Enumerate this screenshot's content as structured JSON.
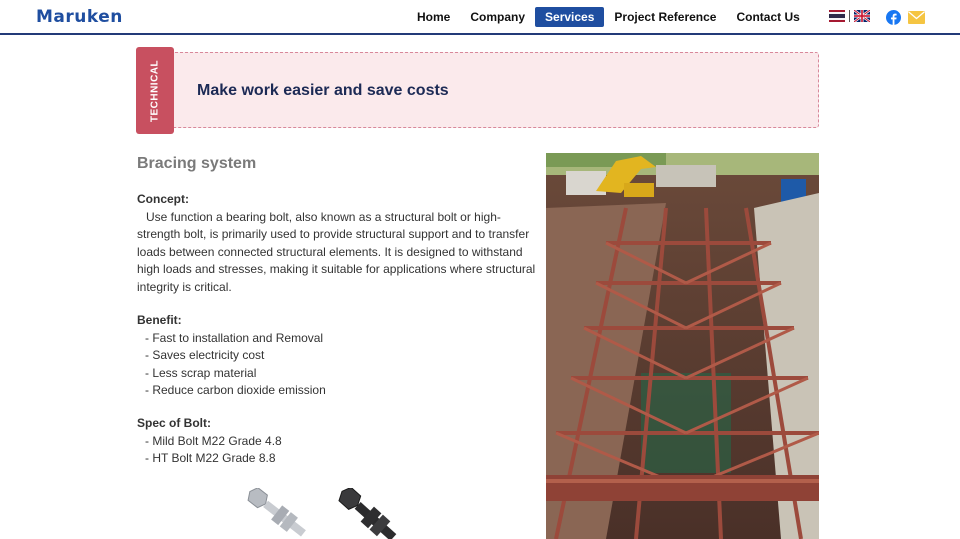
{
  "header": {
    "logo": "Maruken",
    "nav": [
      {
        "label": "Home"
      },
      {
        "label": "Company"
      },
      {
        "label": "Services",
        "active": true
      },
      {
        "label": "Project Reference"
      },
      {
        "label": "Contact Us"
      }
    ],
    "icons": [
      "thai-flag-icon",
      "uk-flag-icon",
      "facebook-icon",
      "mail-icon"
    ]
  },
  "banner": {
    "tab_label": "TECHNICAL",
    "title": "Make work easier and save costs"
  },
  "content": {
    "section_title": "Bracing system",
    "concept_heading": "Concept:",
    "concept_text": "Use function a bearing bolt, also known as a structural bolt or high-strength bolt, is primarily used to provide structural support and to transfer loads between connected structural elements. It is designed to withstand high loads and stresses, making it suitable for applications where structural integrity is critical.",
    "benefit_heading": "Benefit:",
    "benefits": [
      "- Fast to installation and Removal",
      "- Saves electricity cost",
      "- Less scrap material",
      "- Reduce carbon dioxide emission"
    ],
    "spec_heading": "Spec of Bolt:",
    "specs": [
      "- Mild Bolt M22 Grade 4.8",
      "- HT Bolt M22 Grade 8.8"
    ]
  },
  "colors": {
    "brand_blue": "#1f4ea0",
    "banner_bg": "#fbeaec",
    "tab_red": "#c85060",
    "steel_red": "#9c4a3c"
  }
}
